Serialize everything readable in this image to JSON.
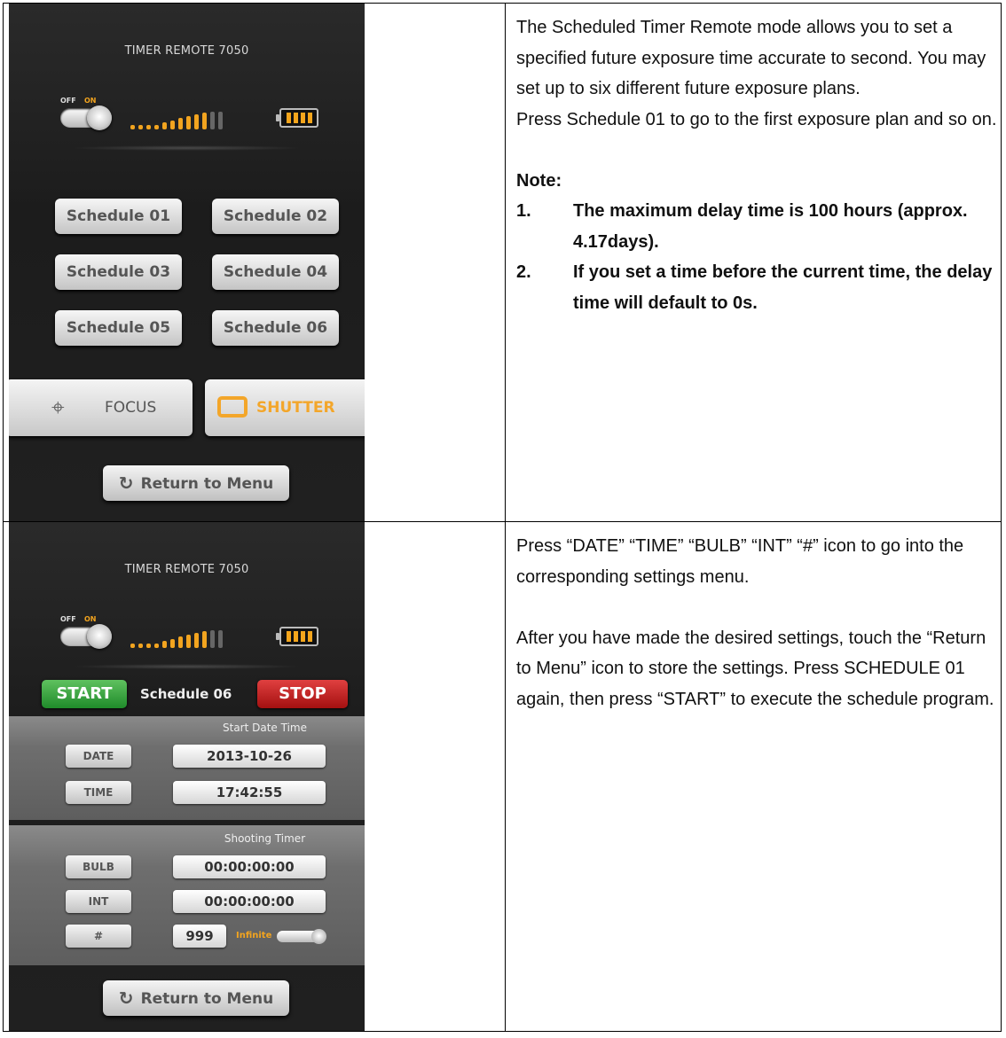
{
  "phone": {
    "title": "TIMER REMOTE 7050",
    "toggle_off": "OFF",
    "toggle_on": "ON",
    "accent_color": "#f2a41f"
  },
  "screen1": {
    "schedules": [
      "Schedule 01",
      "Schedule 02",
      "Schedule 03",
      "Schedule 04",
      "Schedule 05",
      "Schedule 06"
    ],
    "focus_label": "FOCUS",
    "shutter_label": "SHUTTER",
    "return_label": "Return to Menu"
  },
  "screen2": {
    "start_label": "START",
    "schedule_name": "Schedule 06",
    "stop_label": "STOP",
    "start_section_title": "Start Date Time",
    "date_label": "DATE",
    "date_value": "2013-10-26",
    "time_label": "TIME",
    "time_value": "17:42:55",
    "shooting_section_title": "Shooting Timer",
    "bulb_label": "BULB",
    "bulb_value": "00:00:00:00",
    "int_label": "INT",
    "int_value": "00:00:00:00",
    "count_label": "#",
    "count_value": "999",
    "infinite_label": "Infinite",
    "return_label": "Return to Menu"
  },
  "text1": {
    "para1": "The Scheduled Timer Remote mode allows you to set a specified future exposure time accurate to second. You may set up to six different future exposure plans.",
    "para2": "Press Schedule 01 to go to the first exposure plan and so on.",
    "note_heading": "Note:",
    "notes": [
      {
        "num": "1.",
        "text": "The maximum delay time is 100 hours (approx. 4.17days)."
      },
      {
        "num": "2.",
        "text": "If you set a time before the current time, the delay time will default to 0s."
      }
    ]
  },
  "text2": {
    "para1": "Press “DATE” “TIME” “BULB” “INT” “#” icon to go into the corresponding settings menu.",
    "para2": "After you have made the desired settings, touch the “Return to Menu” icon to store the settings. Press SCHEDULE 01 again, then press “START” to execute the schedule program."
  }
}
